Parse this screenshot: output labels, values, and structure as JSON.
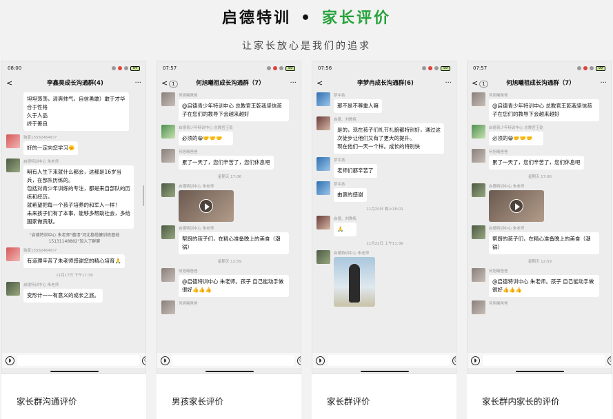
{
  "header": {
    "title_left": "启德特训",
    "title_dot": "•",
    "title_right": "家长评价",
    "subtitle": "让家长放心是我们的追求"
  },
  "colors": {
    "accent": "#27a33b",
    "bubble": "#ffffff",
    "chat_bg": "#ededed"
  },
  "cards": [
    {
      "caption": "家长群沟通评价",
      "status_time": "08:00",
      "battery": "84",
      "title": "李鑫昊成长沟通群(4)",
      "back": "<",
      "back_count": "",
      "items": [
        {
          "kind": "cont",
          "text": "坦坦荡荡，清爽帅气，自信勇敢）敢于才华\n合于性格\n久于人品\n终于善良"
        },
        {
          "kind": "msg",
          "avatar": "av-a",
          "sender": "独家155824646??",
          "text": "好的一定向您学习🌞"
        },
        {
          "kind": "msg",
          "avatar": "av-b",
          "sender": "启德特训中心 朱老师",
          "text": "明有人生下来就什么都会，这都是16岁当兵，在部队历练的。\n包括对青少年训练的专注，都是来自部队的历练和经历。\n就希望把每一个孩子培养的和军人一样！\n未来孩子们有了本事，能够多帮助社会，多给国家做贡献。"
        },
        {
          "kind": "sys",
          "text": "\"启德特训中心 朱老师\"邀请\"河北稳缆健训练基地15131148882\"加入了群聊"
        },
        {
          "kind": "msg",
          "avatar": "av-a",
          "sender": "独家155824646??",
          "text": "有道理辛苦了朱老师感谢您的精心培育🙏"
        },
        {
          "kind": "time",
          "text": "11月17日 下午17:36"
        },
        {
          "kind": "msg",
          "avatar": "av-b",
          "sender": "启德特训中心 朱老师",
          "text": "变形计——有意义的成长之旅。"
        }
      ]
    },
    {
      "caption": "男孩家长评价",
      "status_time": "07:57",
      "battery": "99",
      "title": "何旭曦祖成长沟通群（7）",
      "back": "<",
      "back_count": "1",
      "items": [
        {
          "kind": "msg",
          "avatar": "av-c",
          "sender": "何旭曦爸爸",
          "text": "@启德青少年特训中心 总教官王乾我坚信孩子在您们的教导下会越来越好"
        },
        {
          "kind": "msg",
          "avatar": "av-d",
          "sender": "启德青少年特训中心 总教官王乾",
          "text": "必须的😁🤝🤝🤝"
        },
        {
          "kind": "msg",
          "avatar": "av-c",
          "sender": "何旭曦爸爸",
          "text": "累了一天了，您们辛苦了，您们休息吧"
        },
        {
          "kind": "time",
          "text": "星期天 17:06"
        },
        {
          "kind": "msg",
          "avatar": "av-b",
          "sender": "启德特训中心 朱老师",
          "video": true
        },
        {
          "kind": "msg",
          "avatar": "av-b",
          "sender": "启德特训中心 朱老师",
          "text": "帮厨的孩子们，在精心准备晚上的美食（潮锅）"
        },
        {
          "kind": "time",
          "text": "星期天 12:59"
        },
        {
          "kind": "msg",
          "avatar": "av-c",
          "sender": "何旭曦爸爸",
          "text": "@启德特训中心 朱老师。孩子 自己能动手做很好👍👍👍"
        },
        {
          "kind": "msg",
          "avatar": "av-c",
          "sender": "何旭曦爸爸",
          "text": ""
        }
      ]
    },
    {
      "caption": "家长群评价",
      "status_time": "07:56",
      "battery": "99",
      "title": "李梦冉成长沟通群(6)",
      "back": "<",
      "back_count": "",
      "items": [
        {
          "kind": "msg",
          "avatar": "av-e",
          "sender": "梦中孩",
          "text": "那不是不尊重人嘛"
        },
        {
          "kind": "msg",
          "avatar": "av-f",
          "sender": "启德、刘教练",
          "text": "是的，现在孩子们礼节礼貌都特别好，通过这次徒步让他们又有了更大的提升。\n现在他们一天一个样。成长的特别快"
        },
        {
          "kind": "msg",
          "avatar": "av-e",
          "sender": "梦中孩",
          "text": "老师们都辛苦了"
        },
        {
          "kind": "msg",
          "avatar": "av-e",
          "sender": "梦中孩",
          "text": "由衷的感谢"
        },
        {
          "kind": "time",
          "text": "11月20日 晚上18:01"
        },
        {
          "kind": "msg",
          "avatar": "av-f",
          "sender": "启德、刘教练",
          "text": "🙏"
        },
        {
          "kind": "time",
          "text": "11月22日 上午11:36"
        },
        {
          "kind": "msg",
          "avatar": "av-b",
          "sender": "启德特训中心 朱老师",
          "photo": true
        }
      ]
    },
    {
      "caption": "家长群内家长的评价",
      "status_time": "07:57",
      "battery": "99",
      "title": "何旭曦祖成长沟通群（7）",
      "back": "<",
      "back_count": "1",
      "items": [
        {
          "kind": "msg",
          "avatar": "av-c",
          "sender": "何旭曦爸爸",
          "text": "@启德青少年特训中心 总教官王乾我坚信孩子在您们的教导下会越来越好"
        },
        {
          "kind": "msg",
          "avatar": "av-d",
          "sender": "启德青少年特训中心 总教官王乾",
          "text": "必须的😁🤝🤝🤝"
        },
        {
          "kind": "msg",
          "avatar": "av-c",
          "sender": "何旭曦爸爸",
          "text": "累了一天了，您们辛苦了，您们休息吧"
        },
        {
          "kind": "time",
          "text": "星期天 17:06"
        },
        {
          "kind": "msg",
          "avatar": "av-b",
          "sender": "启德特训中心 朱老师",
          "video": true
        },
        {
          "kind": "msg",
          "avatar": "av-b",
          "sender": "启德特训中心 朱老师",
          "text": "帮厨的孩子们，在精心准备晚上的美食（潮锅）"
        },
        {
          "kind": "time",
          "text": "星期天 12:59"
        },
        {
          "kind": "msg",
          "avatar": "av-c",
          "sender": "何旭曦爸爸",
          "text": "@启德特训中心 朱老师。孩子 自己能动手做很好👍👍👍"
        },
        {
          "kind": "msg",
          "avatar": "av-c",
          "sender": "何旭曦爸爸",
          "text": ""
        }
      ]
    }
  ]
}
